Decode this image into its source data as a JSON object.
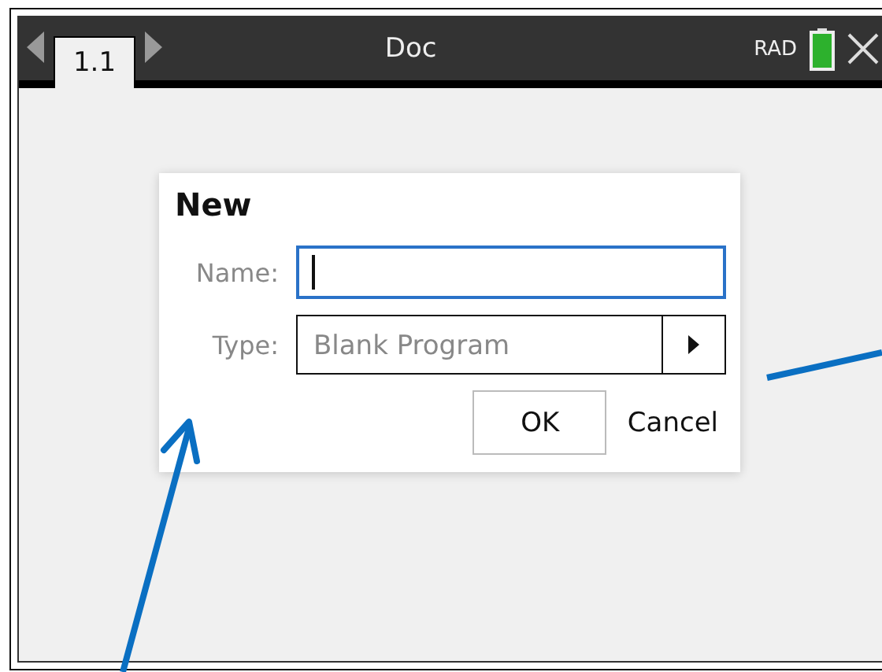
{
  "tabs": [
    {
      "label": "1.1",
      "selected": true
    }
  ],
  "document_title": "Doc",
  "angle_mode": "RAD",
  "dialog": {
    "title": "New",
    "fields": [
      {
        "kind": "text",
        "label": "Name:",
        "focused": true
      },
      {
        "kind": "dropdown",
        "label": "Type:",
        "value": "Blank Program",
        "focused": false
      }
    ],
    "buttons": [
      {
        "label": "OK",
        "default": true
      },
      {
        "label": "Cancel",
        "default": false
      }
    ]
  }
}
